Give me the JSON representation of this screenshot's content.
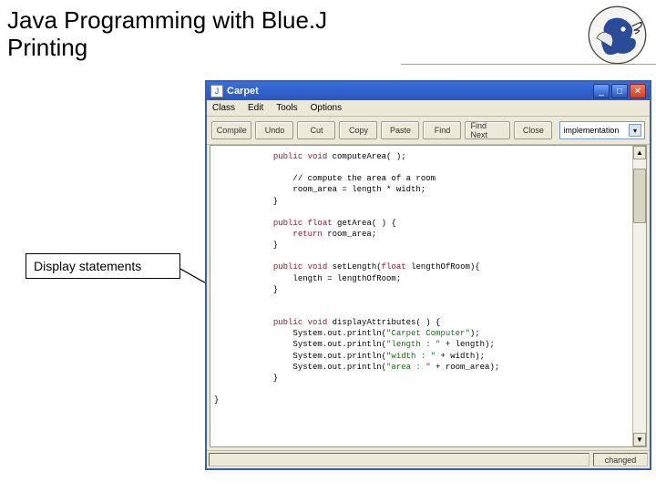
{
  "slide": {
    "title": "Java Programming with Blue.J\nPrinting",
    "callout": "Display statements"
  },
  "window": {
    "title": "Carpet",
    "menubar": [
      "Class",
      "Edit",
      "Tools",
      "Options"
    ],
    "toolbar": {
      "compile": "Compile",
      "undo": "Undo",
      "cut": "Cut",
      "copy": "Copy",
      "paste": "Paste",
      "find": "Find",
      "findnext": "Find Next",
      "close": "Close"
    },
    "view_selector": "implementation",
    "status": "changed",
    "code_lines": [
      {
        "indent": 3,
        "segments": [
          {
            "t": "public",
            "c": "kw"
          },
          {
            "t": " "
          },
          {
            "t": "void",
            "c": "kw"
          },
          {
            "t": " computeArea( );"
          }
        ]
      },
      {
        "indent": 3,
        "segments": []
      },
      {
        "indent": 4,
        "segments": [
          {
            "t": "// compute the area of a room"
          }
        ]
      },
      {
        "indent": 4,
        "segments": [
          {
            "t": "room_area = length * width;"
          }
        ]
      },
      {
        "indent": 3,
        "segments": [
          {
            "t": "}"
          }
        ]
      },
      {
        "indent": 3,
        "segments": []
      },
      {
        "indent": 3,
        "segments": [
          {
            "t": "public",
            "c": "kw"
          },
          {
            "t": " "
          },
          {
            "t": "float",
            "c": "kw"
          },
          {
            "t": " getArea( ) {"
          }
        ]
      },
      {
        "indent": 4,
        "segments": [
          {
            "t": "return",
            "c": "kw"
          },
          {
            "t": " room_area;"
          }
        ]
      },
      {
        "indent": 3,
        "segments": [
          {
            "t": "}"
          }
        ]
      },
      {
        "indent": 3,
        "segments": []
      },
      {
        "indent": 3,
        "segments": [
          {
            "t": "public",
            "c": "kw"
          },
          {
            "t": " "
          },
          {
            "t": "void",
            "c": "kw"
          },
          {
            "t": " setLength("
          },
          {
            "t": "float",
            "c": "kw"
          },
          {
            "t": " lengthOfRoom){"
          }
        ]
      },
      {
        "indent": 4,
        "segments": [
          {
            "t": "length = lengthOfRoom;"
          }
        ]
      },
      {
        "indent": 3,
        "segments": [
          {
            "t": "}"
          }
        ]
      },
      {
        "indent": 3,
        "segments": []
      },
      {
        "indent": 3,
        "segments": []
      },
      {
        "indent": 3,
        "segments": [
          {
            "t": "public",
            "c": "kw"
          },
          {
            "t": " "
          },
          {
            "t": "void",
            "c": "kw"
          },
          {
            "t": " displayAttributes( ) {"
          }
        ]
      },
      {
        "indent": 4,
        "segments": [
          {
            "t": "System.out.println("
          },
          {
            "t": "\"Carpet Computer\"",
            "c": "str"
          },
          {
            "t": ");"
          }
        ]
      },
      {
        "indent": 4,
        "segments": [
          {
            "t": "System.out.println("
          },
          {
            "t": "\"length : \"",
            "c": "str"
          },
          {
            "t": " + length);"
          }
        ]
      },
      {
        "indent": 4,
        "segments": [
          {
            "t": "System.out.println("
          },
          {
            "t": "\"width : \"",
            "c": "str"
          },
          {
            "t": " + width);"
          }
        ]
      },
      {
        "indent": 4,
        "segments": [
          {
            "t": "System.out.println("
          },
          {
            "t": "\"area : \"",
            "c": "str"
          },
          {
            "t": " + room_area);"
          }
        ]
      },
      {
        "indent": 3,
        "segments": [
          {
            "t": "}"
          }
        ]
      },
      {
        "indent": 0,
        "segments": []
      },
      {
        "indent": 0,
        "segments": [
          {
            "t": "}"
          }
        ]
      }
    ]
  }
}
